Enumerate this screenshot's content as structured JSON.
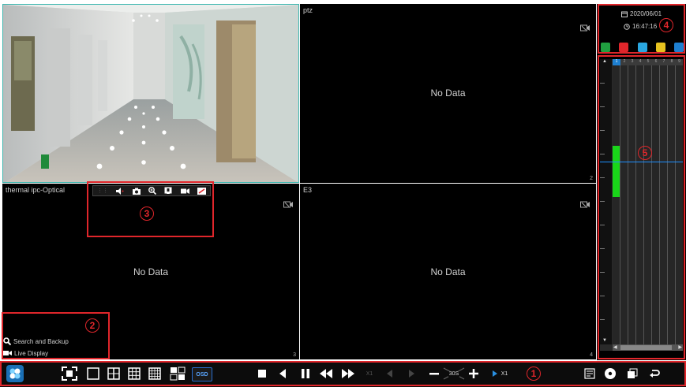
{
  "tiles": {
    "top_left": {
      "title": ""
    },
    "top_right": {
      "title": "ptz",
      "status": "No Data",
      "num": "2"
    },
    "bottom_left": {
      "title": "thermal ipc-Optical",
      "status": "No Data",
      "num": "3"
    },
    "bottom_right": {
      "title": "E3",
      "status": "No Data",
      "num": "4"
    }
  },
  "side_menu": {
    "search_backup": "Search and Backup",
    "live_display": "Live Display"
  },
  "datetime": {
    "date": "2020/06/01",
    "time": "16:47:16"
  },
  "timeline": {
    "column_numbers": [
      "1",
      "2",
      "3",
      "4",
      "5",
      "6",
      "7",
      "8",
      "9"
    ],
    "selected_column": "1"
  },
  "toolbar": {
    "osd_label": "OSD",
    "speed_label": "X1",
    "interval_label": "30S",
    "play_speed_label": "X1"
  },
  "callouts": [
    "1",
    "2",
    "3",
    "4",
    "5"
  ],
  "colors": {
    "accent": "#e0262b",
    "timeline_record": "#19d619",
    "cursor_line": "#1e90ff",
    "tile_bg": "#000000",
    "selected_border": "#3fb7b0"
  }
}
